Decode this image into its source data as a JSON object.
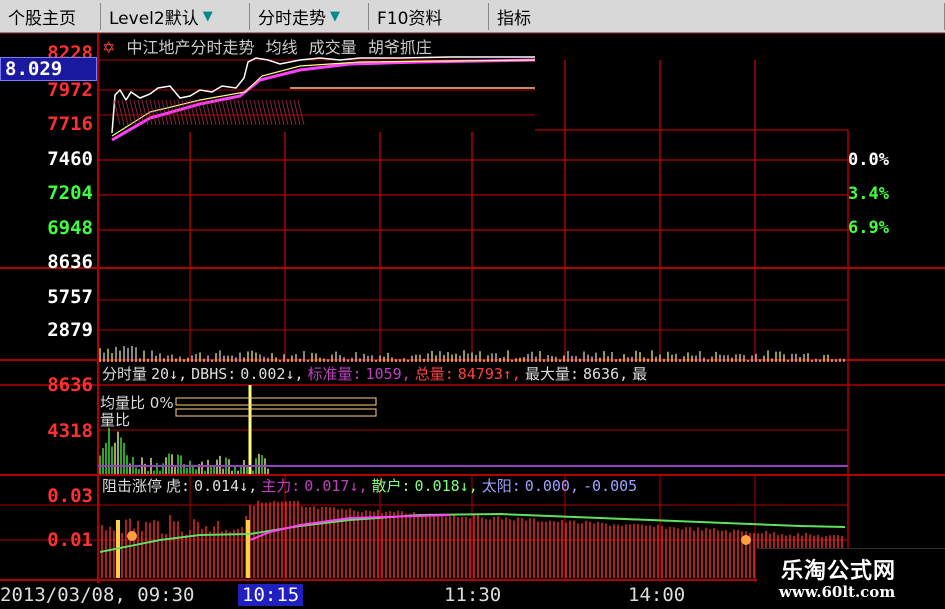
{
  "tabs": [
    {
      "label": "个股主页",
      "arrow": false
    },
    {
      "label": "Level2默认",
      "arrow": true
    },
    {
      "label": "分时走势",
      "arrow": true
    },
    {
      "label": "F10资料",
      "arrow": false
    },
    {
      "label": "指标",
      "arrow": false
    }
  ],
  "price_panel": {
    "title_star": "✡",
    "title_parts": [
      "中江地产分时走势",
      "均线",
      "成交量",
      "胡爷抓庄"
    ],
    "current_price_box": "8.029",
    "left_axis": [
      "8228",
      "7972",
      "7716",
      "7460",
      "7204",
      "6948"
    ],
    "right_axis": [
      "0.0%",
      "3.4%",
      "6.9%"
    ]
  },
  "volume_panel": {
    "left_axis": [
      "8636",
      "5757",
      "2879"
    ],
    "indicator_row": [
      {
        "text": "分时量",
        "color": "#dddddd"
      },
      {
        "text": "20↓,",
        "color": "#dddddd"
      },
      {
        "text": "DBHS:",
        "color": "#dddddd"
      },
      {
        "text": "0.002↓,",
        "color": "#dddddd"
      },
      {
        "text": "标准量:",
        "color": "#c040c0"
      },
      {
        "text": "1059,",
        "color": "#c040c0"
      },
      {
        "text": "总量:",
        "color": "#ff4040"
      },
      {
        "text": "84793↑,",
        "color": "#ff4040"
      },
      {
        "text": "最大量:",
        "color": "#dddddd"
      },
      {
        "text": "8636,",
        "color": "#dddddd"
      },
      {
        "text": "最",
        "color": "#dddddd"
      }
    ]
  },
  "sub_panel": {
    "left_axis": [
      "8636",
      "4318"
    ],
    "label1": "均量比",
    "label1_value": "0%",
    "label2": "量比"
  },
  "indicator_panel": {
    "left_axis": [
      "0.03",
      "0.01"
    ],
    "indicator_row": [
      {
        "text": "阻击涨停",
        "color": "#dddddd"
      },
      {
        "text": "虎:",
        "color": "#dddddd"
      },
      {
        "text": "0.014↓,",
        "color": "#dddddd"
      },
      {
        "text": "主力:",
        "color": "#c040c0"
      },
      {
        "text": "0.017↓,",
        "color": "#c040c0"
      },
      {
        "text": "散户:",
        "color": "#80ff80"
      },
      {
        "text": "0.018↓,",
        "color": "#80ff80"
      },
      {
        "text": "太阳:",
        "color": "#a0a0ff"
      },
      {
        "text": "0.000,",
        "color": "#a0a0ff"
      },
      {
        "text": "-0.005",
        "color": "#a0a0ff"
      }
    ]
  },
  "x_axis": {
    "labels": [
      "2013/03/08, 09:30",
      "10:15",
      "11:30",
      "14:00"
    ],
    "highlighted_index": 1
  },
  "watermark": {
    "name": "乐淘公式网",
    "url": "www.60lt.com"
  },
  "colors": {
    "grid": "#b00000",
    "up": "#ff3030",
    "down": "#40ff40",
    "price_line": "#ffffff",
    "avg_line": "#ffff80",
    "magenta": "#ff40ff",
    "volume_bar": "#ffff80",
    "accent_box": "#1a1aa0"
  }
}
